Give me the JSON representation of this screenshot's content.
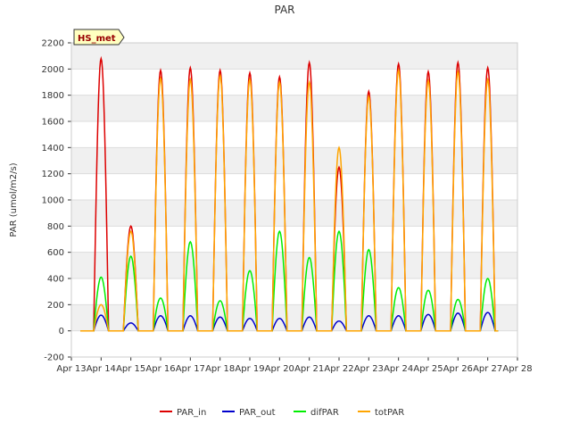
{
  "chart_data": {
    "type": "line",
    "title": "PAR",
    "badge": "HS_met",
    "xlabel": "",
    "ylabel": "PAR (umol/m2/s)",
    "xlim": [
      13,
      28
    ],
    "ylim": [
      -200,
      2200
    ],
    "x_ticks": [
      {
        "value": 13,
        "label": "Apr 13"
      },
      {
        "value": 14,
        "label": "Apr 14"
      },
      {
        "value": 15,
        "label": "Apr 15"
      },
      {
        "value": 16,
        "label": "Apr 16"
      },
      {
        "value": 17,
        "label": "Apr 17"
      },
      {
        "value": 18,
        "label": "Apr 18"
      },
      {
        "value": 19,
        "label": "Apr 19"
      },
      {
        "value": 20,
        "label": "Apr 20"
      },
      {
        "value": 21,
        "label": "Apr 21"
      },
      {
        "value": 22,
        "label": "Apr 22"
      },
      {
        "value": 23,
        "label": "Apr 23"
      },
      {
        "value": 24,
        "label": "Apr 24"
      },
      {
        "value": 25,
        "label": "Apr 25"
      },
      {
        "value": 26,
        "label": "Apr 26"
      },
      {
        "value": 27,
        "label": "Apr 27"
      },
      {
        "value": 28,
        "label": "Apr 28"
      }
    ],
    "y_ticks": [
      -200,
      0,
      200,
      400,
      600,
      800,
      1000,
      1200,
      1400,
      1600,
      1800,
      2000,
      2200
    ],
    "grid": true,
    "legend_position": "bottom",
    "series": [
      {
        "name": "PAR_in",
        "color": "#dd0000",
        "day_peaks": [
          2080,
          800,
          1990,
          2010,
          1990,
          1970,
          1940,
          2050,
          1250,
          1830,
          2040,
          1980,
          2050,
          2010
        ]
      },
      {
        "name": "PAR_out",
        "color": "#0000cc",
        "day_peaks": [
          120,
          60,
          115,
          115,
          105,
          95,
          95,
          105,
          75,
          115,
          115,
          125,
          135,
          140
        ]
      },
      {
        "name": "difPAR",
        "color": "#00ee00",
        "day_peaks": [
          410,
          570,
          250,
          680,
          230,
          460,
          760,
          560,
          760,
          620,
          330,
          310,
          240,
          400
        ]
      },
      {
        "name": "totPAR",
        "color": "#ffa500",
        "day_peaks": [
          200,
          760,
          1930,
          1920,
          1950,
          1920,
          1900,
          1900,
          1400,
          1790,
          1990,
          1910,
          1980,
          1920
        ]
      }
    ]
  }
}
